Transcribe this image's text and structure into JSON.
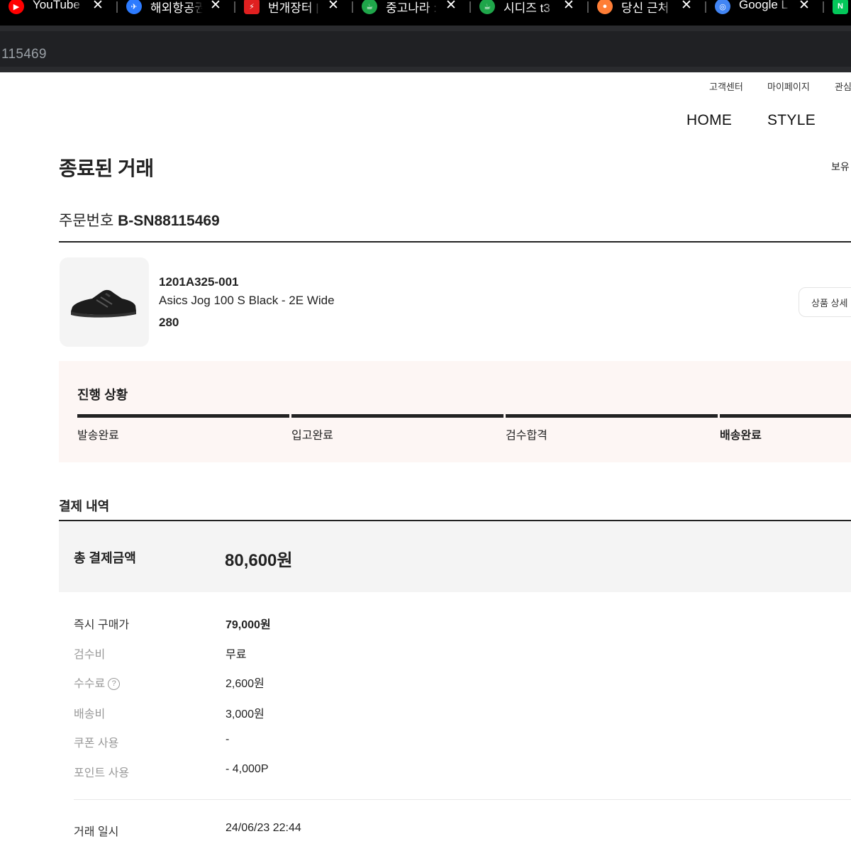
{
  "browser": {
    "tabs": [
      {
        "title": "YouTube",
        "icon": "youtube-icon",
        "color": "#ff0000"
      },
      {
        "title": "해외항공권",
        "icon": "flight-search-icon",
        "color": "#2d7bff"
      },
      {
        "title": "번개장터 |",
        "icon": "lightning-icon",
        "color": "#e02020"
      },
      {
        "title": "중고나라 :",
        "icon": "cafe-icon",
        "color": "#1fa64a"
      },
      {
        "title": "시디즈 t3",
        "icon": "cafe-icon",
        "color": "#1fa64a"
      },
      {
        "title": "당신 근처",
        "icon": "carrot-icon",
        "color": "#ff7e36"
      },
      {
        "title": "Google L",
        "icon": "google-lens-icon",
        "color": "#4285f4"
      },
      {
        "title": "",
        "icon": "naver-icon",
        "color": "#03c75a"
      }
    ],
    "url": "115469"
  },
  "header": {
    "util_links": [
      "고객센터",
      "마이페이지",
      "관심"
    ],
    "nav": [
      "HOME",
      "STYLE"
    ]
  },
  "page": {
    "title": "종료된 거래",
    "right_cut": "보유",
    "order_label": "주문번호",
    "order_number": "B-SN88115469"
  },
  "product": {
    "model": "1201A325-001",
    "name": "Asics Jog 100 S Black - 2E Wide",
    "size": "280",
    "detail_button": "상품 상세"
  },
  "progress": {
    "title": "진행 상황",
    "steps": [
      {
        "label": "발송완료",
        "active": false
      },
      {
        "label": "입고완료",
        "active": false
      },
      {
        "label": "검수합격",
        "active": false
      },
      {
        "label": "배송완료",
        "active": true
      }
    ]
  },
  "payment": {
    "title": "결제 내역",
    "total_label": "총 결제금액",
    "total_value": "80,600원",
    "rows": [
      {
        "label": "즉시 구매가",
        "value": "79,000원"
      },
      {
        "label": "검수비",
        "value": "무료"
      },
      {
        "label": "수수료",
        "value": "2,600원"
      },
      {
        "label": "배송비",
        "value": "3,000원"
      },
      {
        "label": "쿠폰 사용",
        "value": "-"
      },
      {
        "label": "포인트 사용",
        "value": "- 4,000P"
      }
    ],
    "help_mark": "?",
    "date_label": "거래 일시",
    "date_value": "24/06/23 22:44"
  }
}
